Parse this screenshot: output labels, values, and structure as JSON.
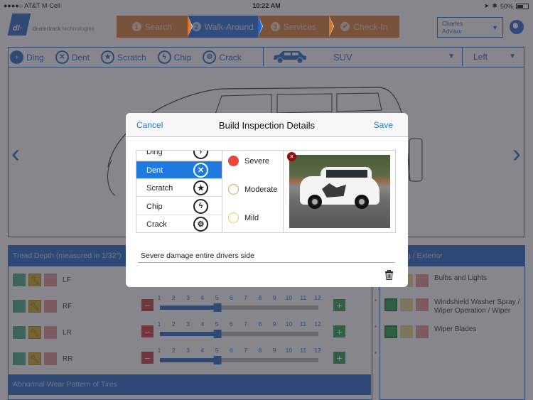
{
  "status_bar": {
    "carrier": "●●●●○ AT&T M-Cell",
    "time": "10:22 AM",
    "battery": "50%",
    "battery_level": 0.5
  },
  "brand": {
    "mark": "dl·",
    "name_bold": "dealertrack",
    "name_rest": " technologies"
  },
  "steps": [
    {
      "num": "1",
      "label": "Search",
      "active": false
    },
    {
      "num": "2",
      "label": "Walk-Around",
      "active": true
    },
    {
      "num": "3",
      "label": "Services",
      "active": false
    },
    {
      "num": "✔",
      "label": "Check-In",
      "active": false
    }
  ],
  "advisor": {
    "line1": "Charles",
    "line2": "Advisor",
    "caret": "▼"
  },
  "damage_types": [
    {
      "label": "Ding",
      "icon": "›",
      "icon_name": "ding-icon"
    },
    {
      "label": "Dent",
      "icon": "✕",
      "icon_name": "dent-icon"
    },
    {
      "label": "Scratch",
      "icon": "★",
      "icon_name": "scratch-icon"
    },
    {
      "label": "Chip",
      "icon": "ϟ",
      "icon_name": "chip-icon"
    },
    {
      "label": "Crack",
      "icon": "⚙",
      "icon_name": "crack-icon"
    }
  ],
  "vehicle": {
    "type": "SUV",
    "side": "Left",
    "caret": "▼"
  },
  "nav": {
    "prev": "‹",
    "next": "›"
  },
  "tread": {
    "title": "Tread Depth (measured in 1/32\")",
    "ticks": [
      "1",
      "2",
      "3",
      "4",
      "5",
      "6",
      "7",
      "8",
      "9",
      "10",
      "11",
      "12"
    ],
    "tires": [
      {
        "label": "LF",
        "value": 5
      },
      {
        "label": "RF",
        "value": 5
      },
      {
        "label": "LR",
        "value": 5
      },
      {
        "label": "RR",
        "value": 5
      }
    ],
    "range": [
      1,
      12
    ],
    "minus": "−",
    "plus": "+",
    "required_mark": "*",
    "footer": "Abnormal Wear Pattern of Tires"
  },
  "exterior": {
    "title": "Lighting / Exterior",
    "items": [
      "Bulbs and Lights",
      "Windshield Washer Spray / Wiper Operation / Wiper",
      "Wiper Blades"
    ]
  },
  "modal": {
    "cancel": "Cancel",
    "title": "Build Inspection Details",
    "save": "Save",
    "types": [
      {
        "label": "Ding",
        "icon": "›",
        "selected": false
      },
      {
        "label": "Dent",
        "icon": "✕",
        "selected": true
      },
      {
        "label": "Scratch",
        "icon": "★",
        "selected": false
      },
      {
        "label": "Chip",
        "icon": "ϟ",
        "selected": false
      },
      {
        "label": "Crack",
        "icon": "⚙",
        "selected": false
      }
    ],
    "severities": [
      {
        "label": "Severe",
        "color": "#e8473a",
        "selected": true
      },
      {
        "label": "Moderate",
        "color": "#ef9a4a",
        "selected": false
      },
      {
        "label": "Mild",
        "color": "#f2cc3c",
        "selected": false
      }
    ],
    "photo_delete": "×",
    "notes": "Severe damage entire drivers side"
  }
}
